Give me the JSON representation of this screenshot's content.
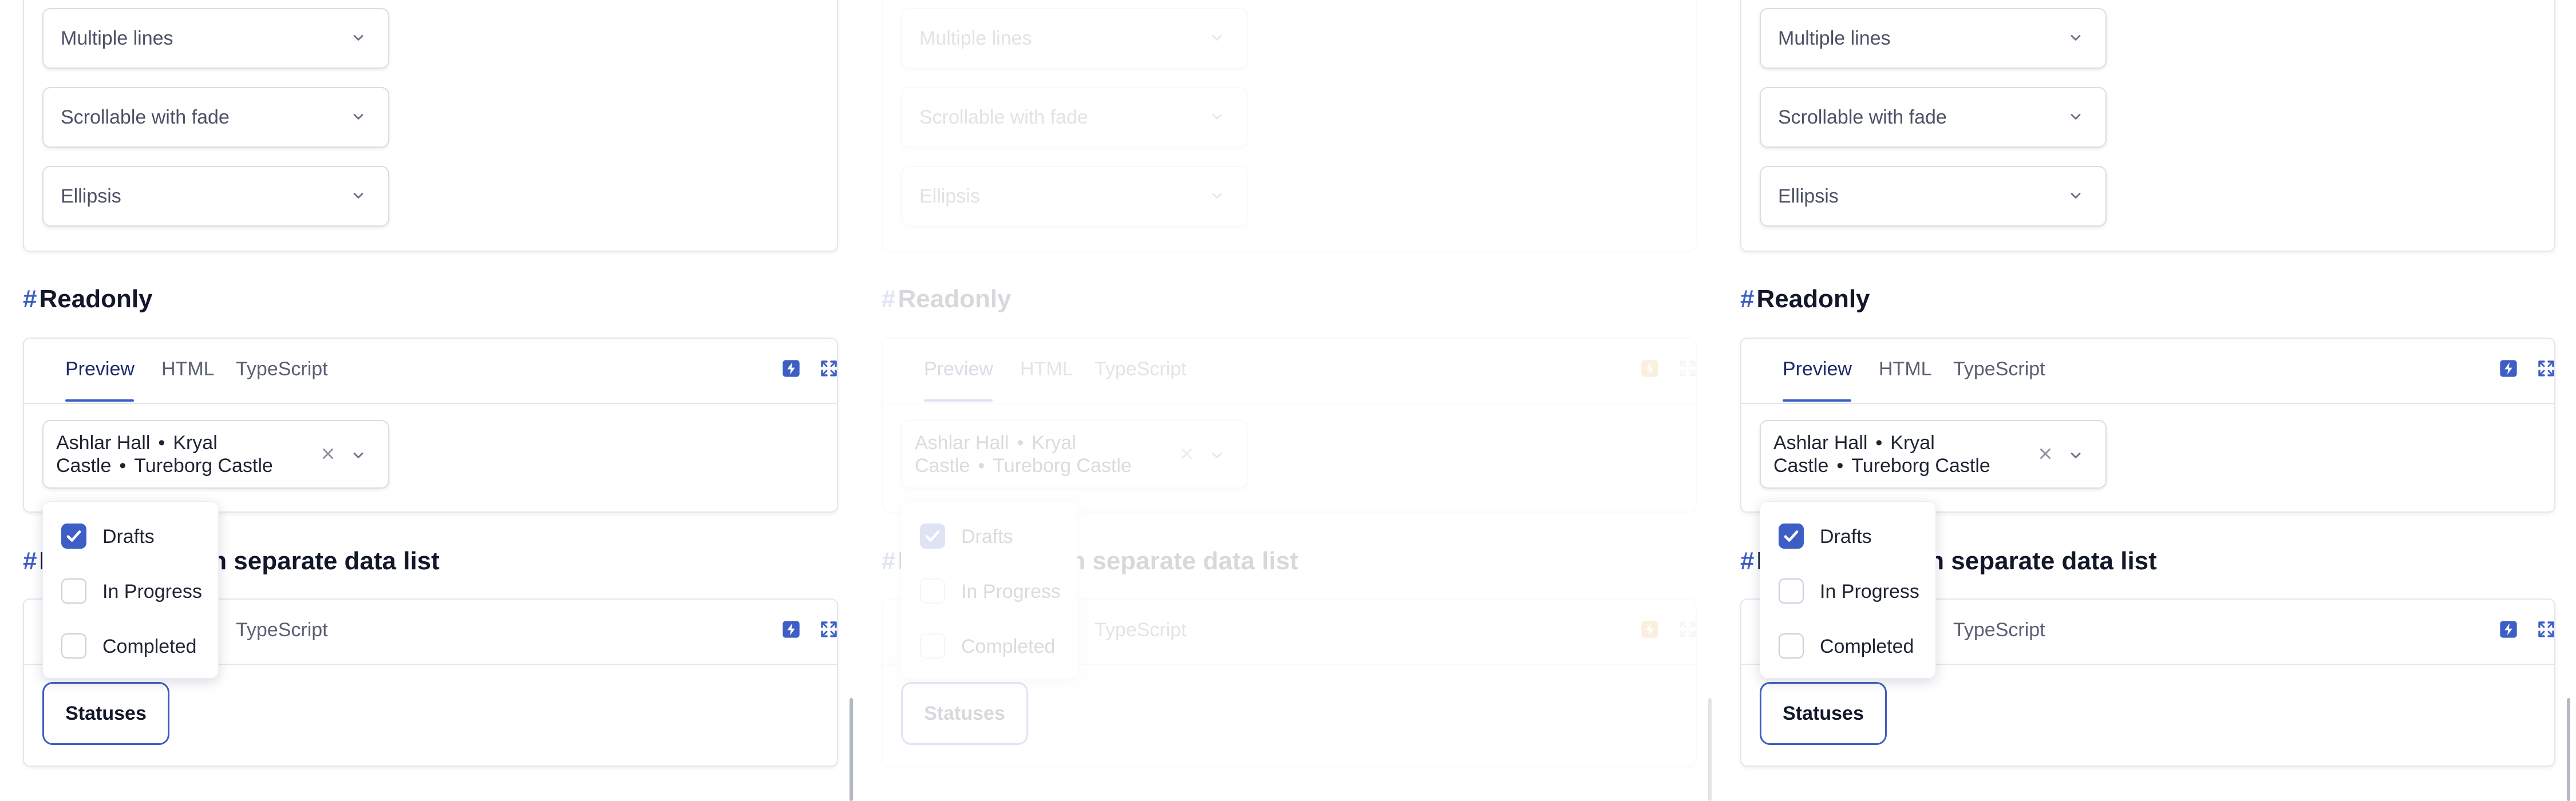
{
  "selects": [
    "Multiple lines",
    "Scrollable with fade",
    "Ellipsis"
  ],
  "readonly_heading": "Readonly",
  "separate_heading": "Multiselect with separate data list",
  "tabs": [
    "Preview",
    "HTML",
    "TypeScript"
  ],
  "readonly_values": [
    "Ashlar Hall",
    "Kryal Castle",
    "Tureborg Castle"
  ],
  "bullet": "•",
  "options": [
    {
      "label": "Drafts",
      "checked": true
    },
    {
      "label": "In Progress",
      "checked": false
    },
    {
      "label": "Completed",
      "checked": false
    }
  ],
  "statuses_button": "Statuses",
  "icons": {
    "chevron": "chevron-down-icon",
    "clear": "close-icon",
    "sandbox": "stackblitz-icon",
    "fullscreen": "fullscreen-icon"
  },
  "colors": {
    "accent": "#3d5ec4",
    "sandbox_dim": "#e8a33a"
  }
}
